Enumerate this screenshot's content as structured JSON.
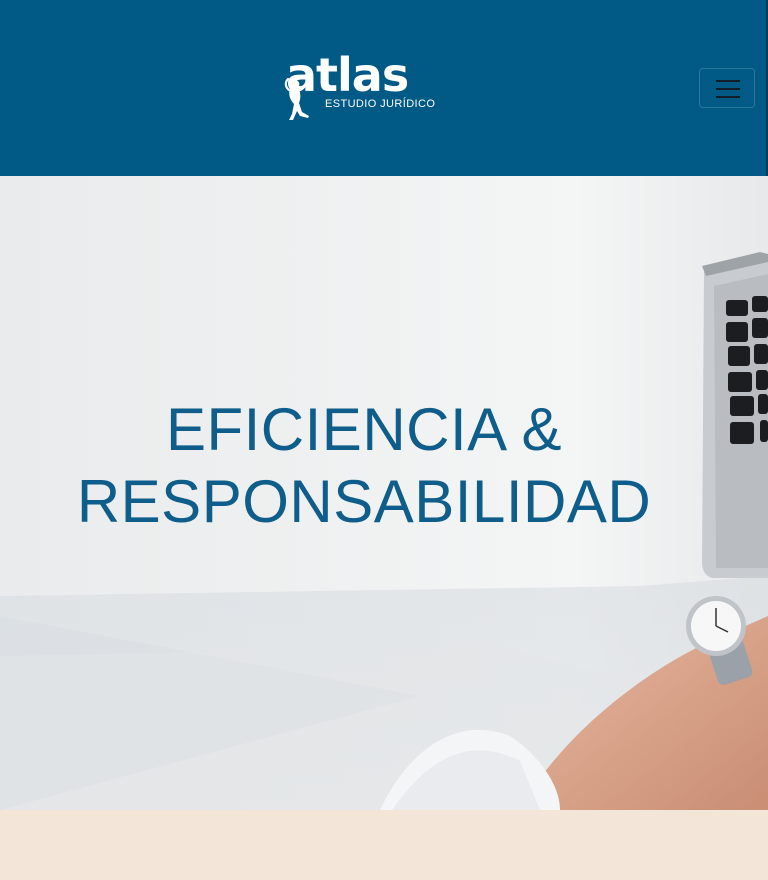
{
  "header": {
    "logo": {
      "word": "atlas",
      "tagline": "ESTUDIO JURÍDICO"
    },
    "menu_toggle": {
      "icon": "hamburger-menu-icon",
      "label": "Toggle navigation"
    },
    "colors": {
      "background": "#015986",
      "logo": "#ffffff"
    }
  },
  "hero": {
    "title_line1": "EFICIENCIA &",
    "title_line2": "RESPONSABILIDAD",
    "colors": {
      "title": "#0e5d8a"
    }
  },
  "next_section": {
    "colors": {
      "background": "#f4e5d9"
    }
  }
}
